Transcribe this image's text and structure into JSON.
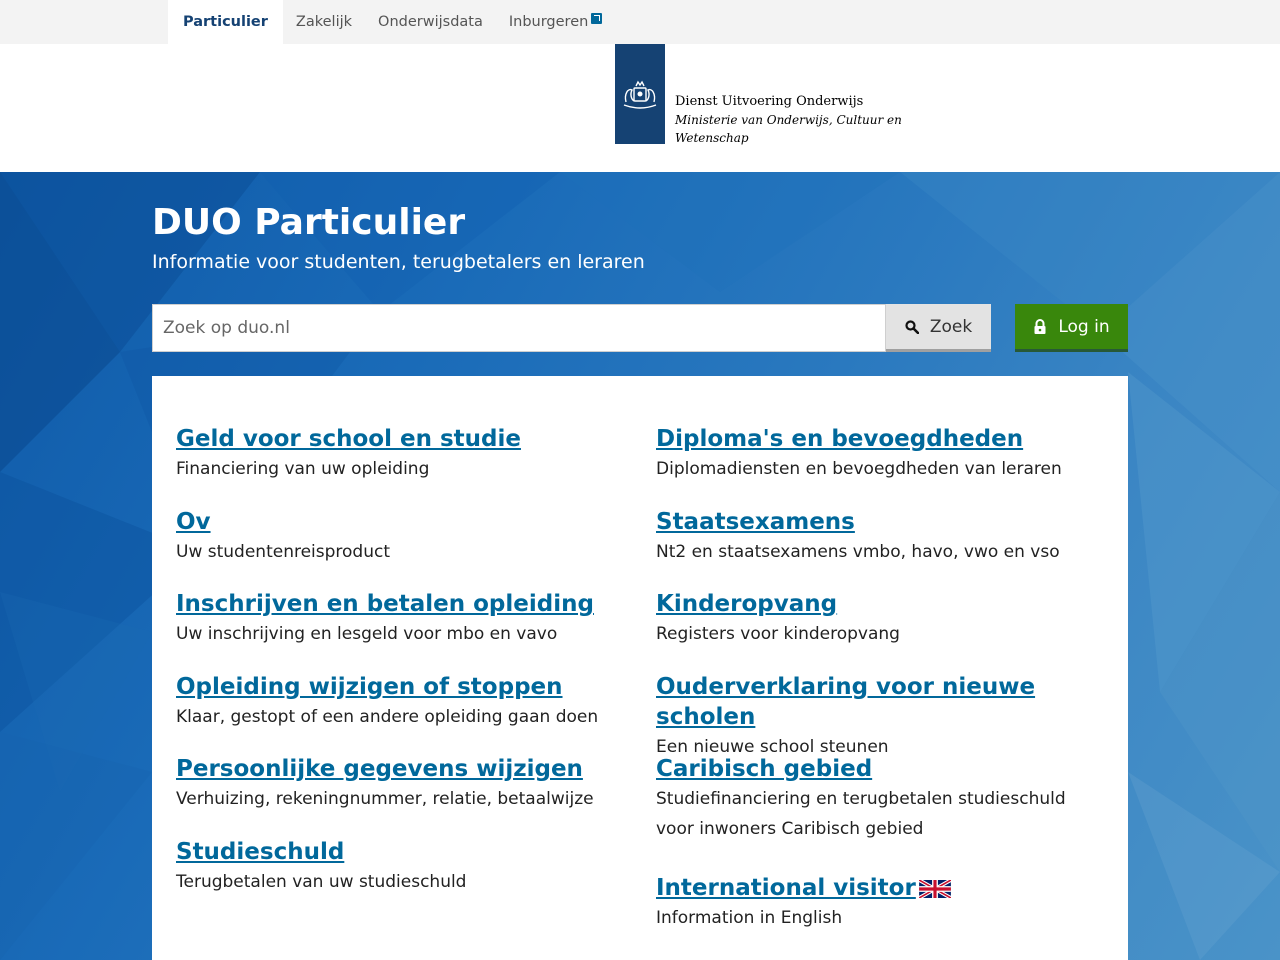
{
  "topnav": {
    "items": [
      {
        "label": "Particulier"
      },
      {
        "label": "Zakelijk"
      },
      {
        "label": "Onderwijsdata"
      },
      {
        "label": "Inburgeren"
      }
    ]
  },
  "logo": {
    "line1": "Dienst Uitvoering Onderwijs",
    "line2": "Ministerie van Onderwijs, Cultuur en",
    "line3": "Wetenschap"
  },
  "hero": {
    "title": "DUO Particulier",
    "subtitle": "Informatie voor studenten, terugbetalers en leraren",
    "search_placeholder": "Zoek op duo.nl",
    "search_label": "Zoek",
    "login_label": "Log in"
  },
  "left": [
    {
      "title": "Geld voor school en studie",
      "desc": "Financiering van uw opleiding"
    },
    {
      "title": "Ov",
      "desc": "Uw studentenreisproduct"
    },
    {
      "title": "Inschrijven en betalen opleiding",
      "desc": "Uw inschrijving en lesgeld voor mbo en vavo"
    },
    {
      "title": "Opleiding wijzigen of stoppen",
      "desc": "Klaar, gestopt of een andere opleiding gaan doen"
    },
    {
      "title": "Persoonlijke gegevens wijzigen",
      "desc": "Verhuizing, rekeningnummer, relatie, betaalwijze"
    },
    {
      "title": "Studieschuld",
      "desc": "Terugbetalen van uw studieschuld"
    }
  ],
  "right": [
    {
      "title": "Diploma's en bevoegdheden",
      "desc": "Diplomadiensten en bevoegdheden van leraren"
    },
    {
      "title": "Staatsexamens",
      "desc": "Nt2 en staatsexamens vmbo, havo, vwo en vso"
    },
    {
      "title": "Kinderopvang",
      "desc": "Registers voor kinderopvang"
    },
    {
      "title": "Ouderverklaring voor nieuwe scholen",
      "desc": "Een nieuwe school steunen"
    },
    {
      "title": "Caribisch gebied",
      "desc": "Studiefinanciering en terugbetalen studieschuld voor inwoners Caribisch gebied"
    },
    {
      "title": "International visitor",
      "desc": "Information in English"
    }
  ],
  "colors": {
    "link": "#01689b",
    "brand": "#154273",
    "login": "#39870c"
  }
}
